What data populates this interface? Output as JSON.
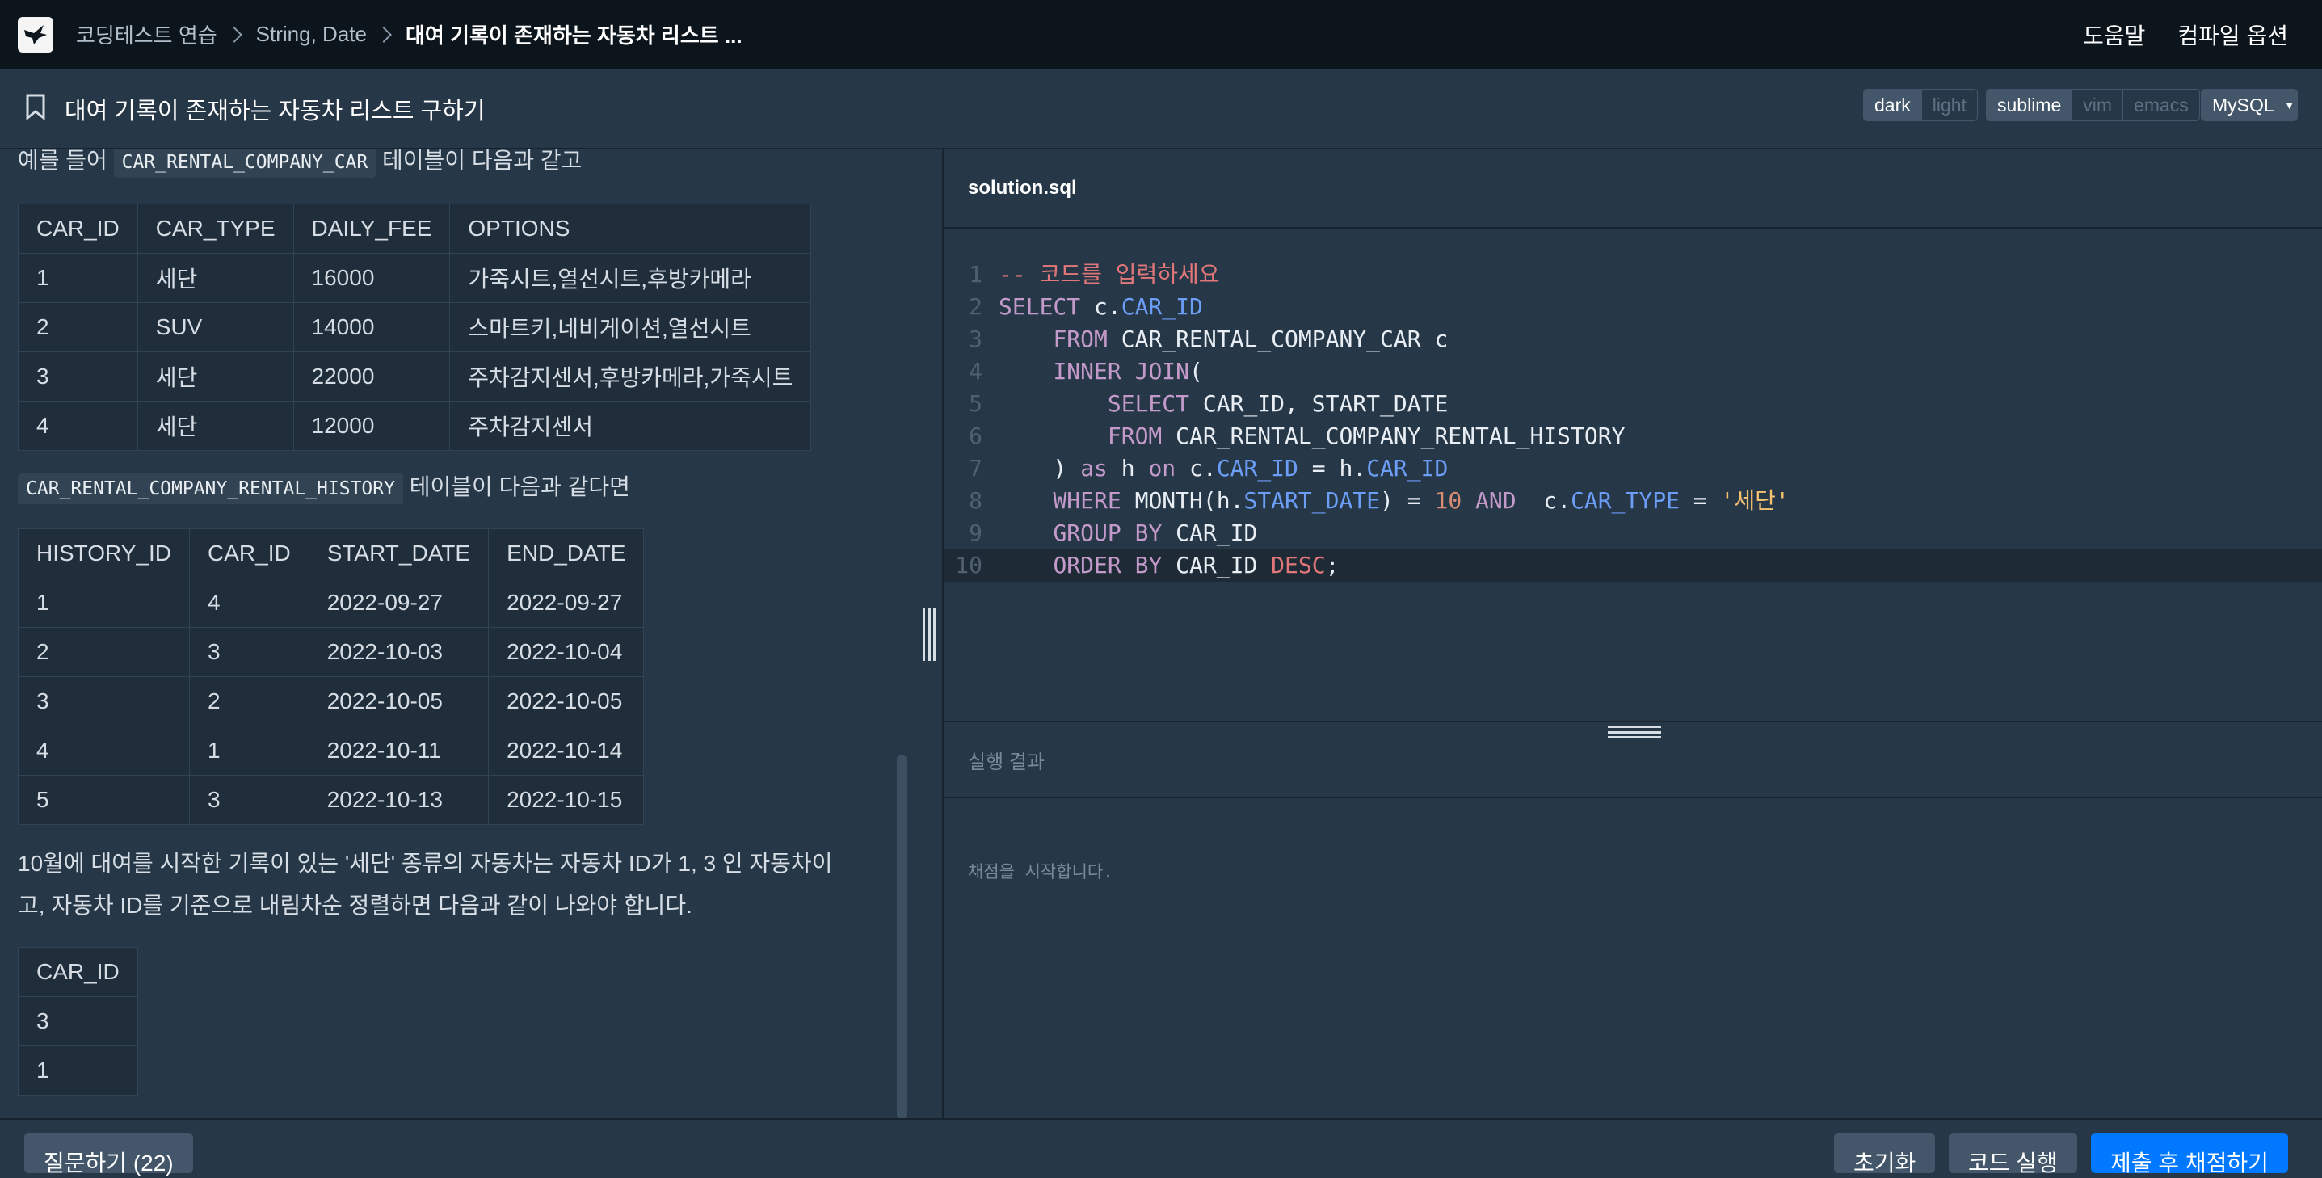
{
  "header": {
    "breadcrumb": [
      "코딩테스트 연습",
      "String, Date",
      "대여 기록이 존재하는 자동차 리스트 ..."
    ],
    "help": "도움말",
    "compile_options": "컴파일 옵션"
  },
  "problem": {
    "title": "대여 기록이 존재하는 자동차 리스트 구하기"
  },
  "toolbar": {
    "themes": [
      "dark",
      "light"
    ],
    "keymaps": [
      "sublime",
      "vim",
      "emacs"
    ],
    "language": "MySQL"
  },
  "content": {
    "intro_prefix": "예를 들어",
    "intro_table": "CAR_RENTAL_COMPANY_CAR",
    "intro_suffix": "테이블이 다음과 같고",
    "car_table": {
      "headers": [
        "CAR_ID",
        "CAR_TYPE",
        "DAILY_FEE",
        "OPTIONS"
      ],
      "rows": [
        [
          "1",
          "세단",
          "16000",
          "가죽시트,열선시트,후방카메라"
        ],
        [
          "2",
          "SUV",
          "14000",
          "스마트키,네비게이션,열선시트"
        ],
        [
          "3",
          "세단",
          "22000",
          "주차감지센서,후방카메라,가죽시트"
        ],
        [
          "4",
          "세단",
          "12000",
          "주차감지센서"
        ]
      ]
    },
    "history_intro_table": "CAR_RENTAL_COMPANY_RENTAL_HISTORY",
    "history_intro_suffix": "테이블이 다음과 같다면",
    "history_table": {
      "headers": [
        "HISTORY_ID",
        "CAR_ID",
        "START_DATE",
        "END_DATE"
      ],
      "rows": [
        [
          "1",
          "4",
          "2022-09-27",
          "2022-09-27"
        ],
        [
          "2",
          "3",
          "2022-10-03",
          "2022-10-04"
        ],
        [
          "3",
          "2",
          "2022-10-05",
          "2022-10-05"
        ],
        [
          "4",
          "1",
          "2022-10-11",
          "2022-10-14"
        ],
        [
          "5",
          "3",
          "2022-10-13",
          "2022-10-15"
        ]
      ]
    },
    "explanation_line1": "10월에 대여를 시작한 기록이 있는 '세단' 종류의 자동차는 자동차 ID가 1, 3 인 자동차이",
    "explanation_line2": "고, 자동차 ID를 기준으로 내림차순 정렬하면 다음과 같이 나와야 합니다.",
    "result_table": {
      "headers": [
        "CAR_ID"
      ],
      "rows": [
        [
          "3"
        ],
        [
          "1"
        ]
      ]
    }
  },
  "editor": {
    "filename": "solution.sql",
    "line_numbers": [
      "1",
      "2",
      "3",
      "4",
      "5",
      "6",
      "7",
      "8",
      "9",
      "10"
    ]
  },
  "result": {
    "heading": "실행 결과",
    "message": "채점을 시작합니다."
  },
  "footer": {
    "question_button": "질문하기 (22)",
    "reset_button": "초기화",
    "run_button": "코드 실행",
    "submit_button": "제출 후 채점하기"
  }
}
